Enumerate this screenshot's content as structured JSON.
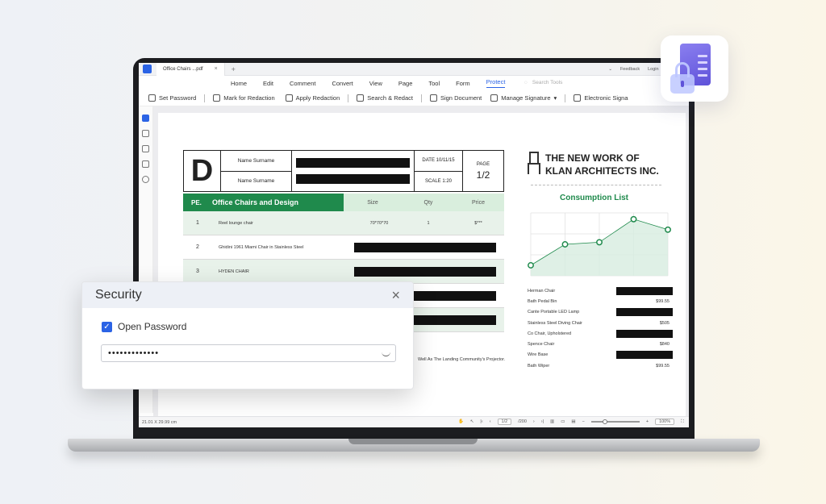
{
  "window": {
    "tab_title": "Office Chairs ...pdf",
    "tab_close": "×",
    "tab_add": "+",
    "feedback": "Feedback",
    "login": "Login"
  },
  "menu": {
    "items": [
      "Home",
      "Edit",
      "Comment",
      "Convert",
      "View",
      "Page",
      "Tool",
      "Form",
      "Protect"
    ],
    "active": "Protect",
    "search_placeholder": "Search Tools"
  },
  "toolbar": {
    "items": [
      "Set Password",
      "Mark for Redaction",
      "Apply Redaction",
      "Search & Redact",
      "Sign Document",
      "Manage Signature",
      "Electronic Signa"
    ]
  },
  "document": {
    "letter": "D",
    "name_label_1": "Name Surname",
    "name_label_2": "Name Surname",
    "date": "DATE 10/11/15",
    "scale": "SCALE 1:20",
    "page_label": "PAGE",
    "page_fraction": "1/2",
    "table_head": {
      "pe": "PE.",
      "title": "Office Chairs and Design",
      "size": "Size",
      "qty": "Qty",
      "price": "Price"
    },
    "rows": [
      {
        "num": "1",
        "name": "Reel lounge chair",
        "size": "70*70*70",
        "qty": "1",
        "price": "$***"
      },
      {
        "num": "2",
        "name": "Ghidini 1961 Miami Chair in Stainless Steel"
      },
      {
        "num": "3",
        "name": "HYDEN CHAIR"
      }
    ],
    "note": "Well As The Landing Community's Projector."
  },
  "brand": {
    "line1": "THE NEW WORK OF",
    "line2": "KLAN ARCHITECTS INC."
  },
  "consumption_title": "Consumption List",
  "chart_data": {
    "type": "line",
    "x": [
      1,
      2,
      3,
      4,
      5
    ],
    "values": [
      1,
      3,
      3.2,
      5.4,
      4.4
    ],
    "ylim": [
      0,
      6
    ],
    "grid": true,
    "accent": "#1f8a4c"
  },
  "price_list": [
    {
      "name": "Herman Chair",
      "value": null
    },
    {
      "name": "Bath Pedal Bin",
      "value": "$99.55"
    },
    {
      "name": "Cante Portable LED Lamp",
      "value": null
    },
    {
      "name": "Stainless Steel Diving Chair",
      "value": "$505"
    },
    {
      "name": "Co Chair, Upholstered",
      "value": null
    },
    {
      "name": "Spence Chair",
      "value": "$840"
    },
    {
      "name": "Wire Base",
      "value": null
    },
    {
      "name": "Bath Wiper",
      "value": "$99.55"
    }
  ],
  "statusbar": {
    "dimensions": "21.01 X 29.99 cm",
    "page_input": "1/2",
    "page_total": "/200",
    "zoom": "100%"
  },
  "security_dialog": {
    "title": "Security",
    "close": "×",
    "checkbox_label": "Open Password",
    "checkbox_checked": true,
    "password_value": "•••••••••••••"
  },
  "colors": {
    "accent": "#2b63e5",
    "green": "#1f8a4c",
    "lock_purple": "#5f52d9"
  }
}
